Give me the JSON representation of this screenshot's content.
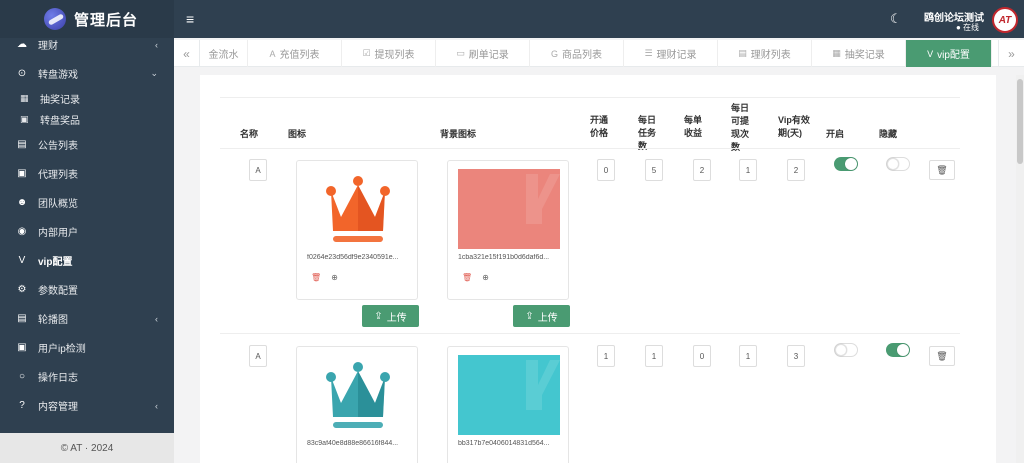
{
  "app": {
    "title": "管理后台",
    "footer": "© AT · 2024"
  },
  "header": {
    "user_name": "鸥创论坛测试",
    "user_status": "● 在线",
    "avatar_text": "AT"
  },
  "sidebar": {
    "items": [
      {
        "label": "理财",
        "icon": "chart-icon",
        "glyph": "☁",
        "chevron": "‹"
      },
      {
        "label": "转盘游戏",
        "icon": "gamepad-icon",
        "glyph": "⊙",
        "chevron": "⌄"
      },
      {
        "label": "抽奖记录",
        "icon": "grid-icon",
        "glyph": "▦",
        "sub": true
      },
      {
        "label": "转盘奖品",
        "icon": "gift-icon",
        "glyph": "▣",
        "sub": true
      },
      {
        "label": "公告列表",
        "icon": "document-icon",
        "glyph": "▤"
      },
      {
        "label": "代理列表",
        "icon": "contact-icon",
        "glyph": "▣"
      },
      {
        "label": "团队概览",
        "icon": "users-icon",
        "glyph": "☻"
      },
      {
        "label": "内部用户",
        "icon": "user-circle-icon",
        "glyph": "◉"
      },
      {
        "label": "vip配置",
        "icon": "vip-icon",
        "glyph": "V",
        "bold": true
      },
      {
        "label": "参数配置",
        "icon": "cogs-icon",
        "glyph": "⚙"
      },
      {
        "label": "轮播图",
        "icon": "image-icon",
        "glyph": "▤",
        "chevron": "‹"
      },
      {
        "label": "用户ip检测",
        "icon": "id-card-icon",
        "glyph": "▣"
      },
      {
        "label": "操作日志",
        "icon": "circle-icon",
        "glyph": "○"
      },
      {
        "label": "内容管理",
        "icon": "question-icon",
        "glyph": "?",
        "chevron": "‹"
      }
    ]
  },
  "tabs": [
    {
      "label": "金流水",
      "icon": "",
      "w": 48
    },
    {
      "label": "充值列表",
      "icon": "A",
      "w": 94
    },
    {
      "label": "提现列表",
      "icon": "☑",
      "w": 94
    },
    {
      "label": "刷单记录",
      "icon": "▭",
      "w": 94
    },
    {
      "label": "商品列表",
      "icon": "G",
      "w": 94
    },
    {
      "label": "理财记录",
      "icon": "☰",
      "w": 94
    },
    {
      "label": "理财列表",
      "icon": "▤",
      "w": 94
    },
    {
      "label": "抽奖记录",
      "icon": "▦",
      "w": 94
    },
    {
      "label": "vip配置",
      "icon": "V",
      "w": 86,
      "active": true
    }
  ],
  "table": {
    "headers": {
      "name": "名称",
      "icon": "图标",
      "bg": "背景图标",
      "price": "开通价格",
      "tasks": "每日任务数",
      "income": "每单收益",
      "withdraw": "每日可提现次数",
      "days": "Vip有效期(天)",
      "open": "开启",
      "hide": "隐藏"
    },
    "rows": [
      {
        "name": "A",
        "icon_file": "f0264e23d56df9e2340591e...",
        "bg_file": "1cba321e15f191b0d6daf6d...",
        "price": "0",
        "tasks": "5",
        "income": "2",
        "withdraw": "1",
        "days": "2",
        "open": true,
        "hide": false,
        "crown_color": "#f2652a",
        "bg_color": "#e9756a"
      },
      {
        "name": "A",
        "icon_file": "83c9af40e8d88e86616f844...",
        "bg_file": "bb317b7e0406014831d564...",
        "price": "1",
        "tasks": "1",
        "income": "0",
        "withdraw": "1",
        "days": "3",
        "open": false,
        "hide": true,
        "crown_color": "#3aa5ae",
        "bg_color": "#2bbfc9"
      }
    ],
    "upload_label": "上传"
  }
}
